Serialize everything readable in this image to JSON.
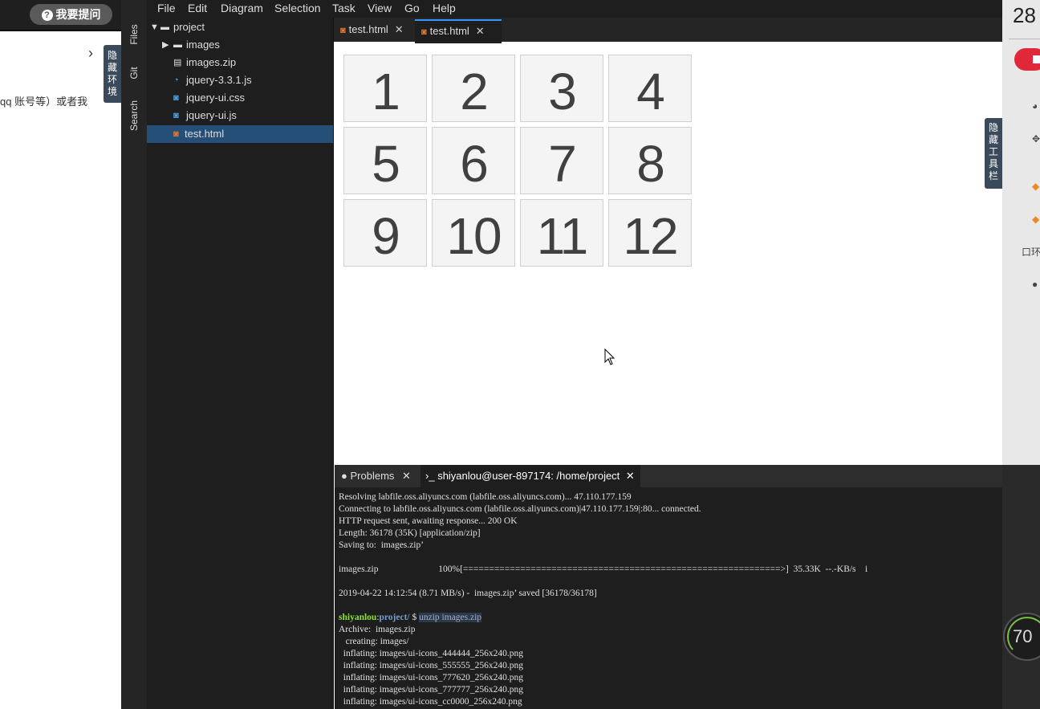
{
  "left_panel": {
    "ask_button": "我要提问",
    "hide_env_label": "隐藏环境",
    "body_text": "qq 账号等）或者我"
  },
  "activity_bar": {
    "files": "Files",
    "git": "Git",
    "search": "Search"
  },
  "menu": [
    "File",
    "Edit",
    "Diagram",
    "Selection",
    "Task",
    "View",
    "Go",
    "Help"
  ],
  "explorer": {
    "items": [
      {
        "label": "project",
        "type": "folder-open"
      },
      {
        "label": "images",
        "type": "folder"
      },
      {
        "label": "images.zip",
        "type": "zip"
      },
      {
        "label": "jquery-3.3.1.js",
        "type": "js"
      },
      {
        "label": "jquery-ui.css",
        "type": "css"
      },
      {
        "label": "jquery-ui.js",
        "type": "js"
      },
      {
        "label": "test.html",
        "type": "html"
      }
    ]
  },
  "editor_tabs": [
    {
      "label": "test.html",
      "active": false
    },
    {
      "label": "test.html",
      "active": true
    }
  ],
  "preview": {
    "cells": [
      "1",
      "2",
      "3",
      "4",
      "5",
      "6",
      "7",
      "8",
      "9",
      "10",
      "11",
      "12"
    ]
  },
  "terminal": {
    "tabs": [
      {
        "label": "Problems",
        "active": false
      },
      {
        "label": "shiyanlou@user-897174: /home/project",
        "active": true
      }
    ],
    "lines": [
      "Resolving labfile.oss.aliyuncs.com (labfile.oss.aliyuncs.com)... 47.110.177.159",
      "Connecting to labfile.oss.aliyuncs.com (labfile.oss.aliyuncs.com)|47.110.177.159|:80... connected.",
      "HTTP request sent, awaiting response... 200 OK",
      "Length: 36178 (35K) [application/zip]",
      "Saving to:  images.zip’",
      "",
      "images.zip                          100%[=============================================================>]  35.33K  --.-KB/s    i",
      "",
      "2019-04-22 14:12:54 (8.71 MB/s) -  images.zip’ saved [36178/36178]",
      ""
    ],
    "prompt_user": "shiyanlou",
    "prompt_path": "project/",
    "prompt_symbol": "$",
    "command": "unzip images.zip",
    "output": [
      "Archive:  images.zip",
      "   creating: images/",
      "  inflating: images/ui-icons_444444_256x240.png",
      "  inflating: images/ui-icons_555555_256x240.png",
      "  inflating: images/ui-icons_777620_256x240.png",
      "  inflating: images/ui-icons_777777_256x240.png",
      "  inflating: images/ui-icons_cc0000_256x240.png"
    ]
  },
  "right_panel": {
    "time_number": "28",
    "hide_tool_label": "隐藏工具栏",
    "gauge_text": "70",
    "side_label": "口环"
  },
  "colors": {
    "accent": "#3794ff",
    "selected_row": "#264f78",
    "html_icon": "#e37933",
    "record": "#e0283a"
  }
}
